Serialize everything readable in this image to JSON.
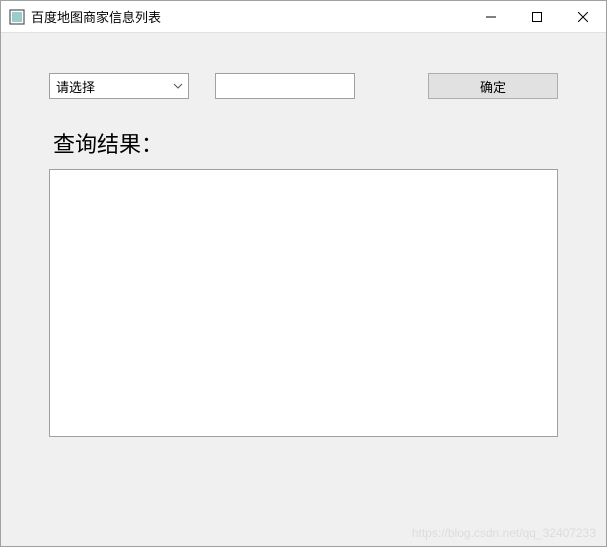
{
  "window": {
    "title": "百度地图商家信息列表"
  },
  "controls": {
    "select_placeholder": "请选择",
    "input_value": "",
    "confirm_label": "确定"
  },
  "results": {
    "label": "查询结果："
  },
  "watermark": "https://blog.csdn.net/qq_32407233"
}
